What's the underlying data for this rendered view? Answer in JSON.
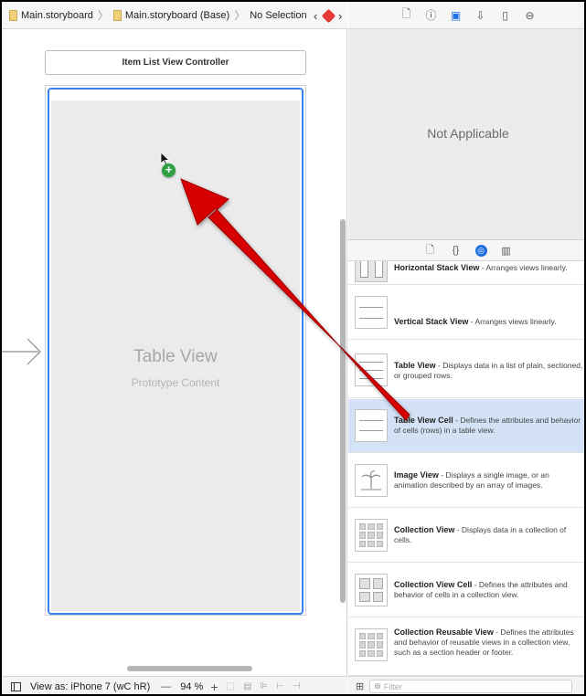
{
  "jumpbar": {
    "crumb1": "Main.storyboard",
    "crumb2": "Main.storyboard (Base)",
    "crumb3": "No Selection"
  },
  "canvas": {
    "vc_title": "Item List View Controller",
    "table_view_title": "Table View",
    "table_view_subtitle": "Prototype Content"
  },
  "bottom_bar": {
    "view_as": "View as: iPhone 7 (wC hR)",
    "zoom_minus": "—",
    "zoom_level": "94 %",
    "zoom_plus": "+"
  },
  "inspector": {
    "message": "Not Applicable"
  },
  "library": {
    "items": [
      {
        "title": "Horizontal Stack View",
        "desc": " - Arranges views linearly."
      },
      {
        "title": "Vertical Stack View",
        "desc": " - Arranges views linearly."
      },
      {
        "title": "Table View",
        "desc": " - Displays data in a list of plain, sectioned, or grouped rows."
      },
      {
        "title": "Table View Cell",
        "desc": " - Defines the attributes and behavior of cells (rows) in a table view."
      },
      {
        "title": "Image View",
        "desc": " - Displays a single image, or an animation described by an array of images."
      },
      {
        "title": "Collection View",
        "desc": " - Displays data in a collection of cells."
      },
      {
        "title": "Collection View Cell",
        "desc": " - Defines the attributes and behavior of cells in a collection view."
      },
      {
        "title": "Collection Reusable View",
        "desc": " - Defines the attributes and behavior of reusable views in a collection view, such as a section header or footer."
      }
    ]
  },
  "filter": {
    "placeholder": "Filter"
  },
  "colors": {
    "accent": "#1d6fe0",
    "selection": "#3b82f6",
    "drag_arrow": "#d60000",
    "add_badge": "#2ea043",
    "selected_row": "#d3e2f5"
  }
}
